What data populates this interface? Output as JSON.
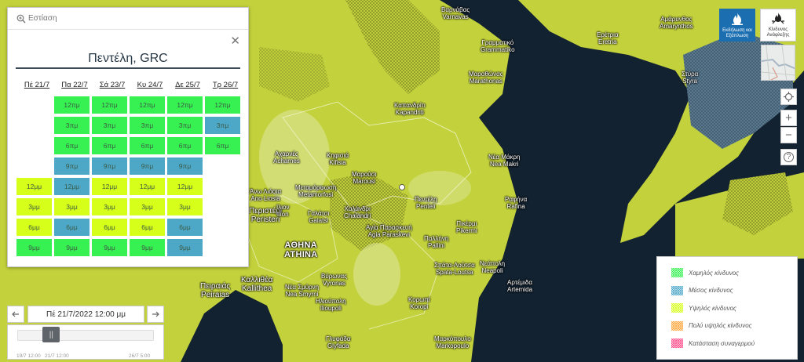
{
  "search": {
    "placeholder": "Εστίαση"
  },
  "forecast": {
    "place": "Πεντέλη, GRC",
    "days": [
      "Πέ 21/7",
      "Πα 22/7",
      "Σά 23/7",
      "Κυ 24/7",
      "Δε 25/7",
      "Τρ 26/7"
    ],
    "columns": [
      {
        "cells": [
          {
            "label": "",
            "level": "none"
          },
          {
            "label": "",
            "level": "none"
          },
          {
            "label": "",
            "level": "none"
          },
          {
            "label": "",
            "level": "none"
          },
          {
            "label": "12μμ",
            "level": "high"
          },
          {
            "label": "3μμ",
            "level": "high"
          },
          {
            "label": "6μμ",
            "level": "high"
          },
          {
            "label": "9μμ",
            "level": "low"
          }
        ]
      },
      {
        "cells": [
          {
            "label": "12πμ",
            "level": "low"
          },
          {
            "label": "3πμ",
            "level": "low"
          },
          {
            "label": "6πμ",
            "level": "low"
          },
          {
            "label": "9πμ",
            "level": "medium"
          },
          {
            "label": "12μμ",
            "level": "medium"
          },
          {
            "label": "3μμ",
            "level": "high"
          },
          {
            "label": "6μμ",
            "level": "medium"
          },
          {
            "label": "9μμ",
            "level": "low"
          }
        ]
      },
      {
        "cells": [
          {
            "label": "12πμ",
            "level": "low"
          },
          {
            "label": "3πμ",
            "level": "low"
          },
          {
            "label": "6πμ",
            "level": "low"
          },
          {
            "label": "9πμ",
            "level": "medium"
          },
          {
            "label": "12μμ",
            "level": "high"
          },
          {
            "label": "3μμ",
            "level": "high"
          },
          {
            "label": "6μμ",
            "level": "high"
          },
          {
            "label": "9μμ",
            "level": "low"
          }
        ]
      },
      {
        "cells": [
          {
            "label": "12πμ",
            "level": "low"
          },
          {
            "label": "3πμ",
            "level": "low"
          },
          {
            "label": "6πμ",
            "level": "low"
          },
          {
            "label": "9πμ",
            "level": "medium"
          },
          {
            "label": "12μμ",
            "level": "high"
          },
          {
            "label": "3μμ",
            "level": "high"
          },
          {
            "label": "6μμ",
            "level": "high"
          },
          {
            "label": "9μμ",
            "level": "low"
          }
        ]
      },
      {
        "cells": [
          {
            "label": "12πμ",
            "level": "low"
          },
          {
            "label": "3πμ",
            "level": "low"
          },
          {
            "label": "6πμ",
            "level": "low"
          },
          {
            "label": "9πμ",
            "level": "medium"
          },
          {
            "label": "12μμ",
            "level": "high"
          },
          {
            "label": "3μμ",
            "level": "high"
          },
          {
            "label": "6μμ",
            "level": "medium"
          },
          {
            "label": "9μμ",
            "level": "medium"
          }
        ]
      },
      {
        "cells": [
          {
            "label": "12πμ",
            "level": "low"
          },
          {
            "label": "3πμ",
            "level": "medium"
          },
          {
            "label": "6πμ",
            "level": "low"
          },
          {
            "label": "",
            "level": "none"
          },
          {
            "label": "",
            "level": "none"
          },
          {
            "label": "",
            "level": "none"
          },
          {
            "label": "",
            "level": "none"
          },
          {
            "label": "",
            "level": "none"
          }
        ]
      }
    ],
    "level_colors": {
      "low": "#37f052",
      "medium": "#4da8c8",
      "high": "#d6ff1a",
      "none": "transparent"
    }
  },
  "time": {
    "current": "Πέ 21/7/2022 12:00 μμ",
    "prev_icon": "arrow-left-icon",
    "next_icon": "arrow-right-icon",
    "position": 0.21,
    "start_label": "19/7 12:00",
    "current_label": "21/7 12:00",
    "end_label": "26/7 5:00"
  },
  "toolbar": {
    "mode_active": "Εκδήλωση και Εξάπλωση",
    "mode_other": "Κίνδυνος Ανάφλεξης",
    "locate_icon": "crosshair-icon",
    "zoom_in": "+",
    "zoom_out": "−",
    "help": "?"
  },
  "legend": {
    "items": [
      {
        "label": "Χαμηλός κίνδυνος",
        "color": "#37f052"
      },
      {
        "label": "Μέσος κίνδυνος",
        "color": "#4da8c8"
      },
      {
        "label": "Υψηλός κίνδυνος",
        "color": "#d6ff1a"
      },
      {
        "label": "Πολύ υψηλός κίνδυνος",
        "color": "#ffa63a"
      },
      {
        "label": "Κατάσταση συναγερμού",
        "color": "#ff4c8a"
      }
    ]
  },
  "map": {
    "labels": [
      {
        "text": "Βαρνάβας\nVarnavas"
      },
      {
        "text": "Γραμματικό\nGrammatiko"
      },
      {
        "text": "Μαραθώνας\nMarathonas"
      },
      {
        "text": "Νέα Μάκρη\nNea Makri"
      },
      {
        "text": "Ραφήνα\nRafina"
      },
      {
        "text": "Πικέρμι\nPikermi"
      },
      {
        "text": "Κηφισιά\nKifisia"
      },
      {
        "text": "Μαρούσι\nMarousi"
      },
      {
        "text": "Χαλάνδρι\nChalandri"
      },
      {
        "text": "Αγία Παρασκευή\nAgia Paraskevi"
      },
      {
        "text": "ΑΘΗΝΑ\nATHINA"
      },
      {
        "text": "Περιστέρι\nPeristeri"
      },
      {
        "text": "Πειραιάς\nPeiraias"
      },
      {
        "text": "Καλλιθέα\nKallithea"
      },
      {
        "text": "Γαλάτσι\nGalatsi"
      },
      {
        "text": "Αχαρνές\nAcharnes"
      },
      {
        "text": "Μεταμόρφωση\nMetamorfosi"
      },
      {
        "text": "Γλυφάδα\nGlyfada"
      },
      {
        "text": "Παλλήνη\nPallini"
      },
      {
        "text": "Σπάτα-Λούτσα\nSpata-Loutsa"
      },
      {
        "text": "Αρτέμιδα\nArtemida"
      },
      {
        "text": "Στύρα\nStyra"
      },
      {
        "text": "Μαρκόπουλο\nMarkopoulo"
      },
      {
        "text": "Βύρωνας\nVyronas"
      },
      {
        "text": "Ηλιούπολη\nIlioupoli"
      },
      {
        "text": "Νέα Σμύρνη\nNea Smyrni"
      },
      {
        "text": "Νεάπολη\nNeapoli"
      },
      {
        "text": "Άνω Λιόσια\nAno Liosia"
      },
      {
        "text": "Καπανδρίτι\nKapandriti"
      },
      {
        "text": "Ερέτρια\nEretria"
      },
      {
        "text": "Αμάρυνθος\nAmarynthos"
      },
      {
        "text": "Ιλιον\nIlion"
      },
      {
        "text": "Κορωπί\nKoropi"
      },
      {
        "text": "Πεντέλη\nPenteli"
      }
    ]
  }
}
